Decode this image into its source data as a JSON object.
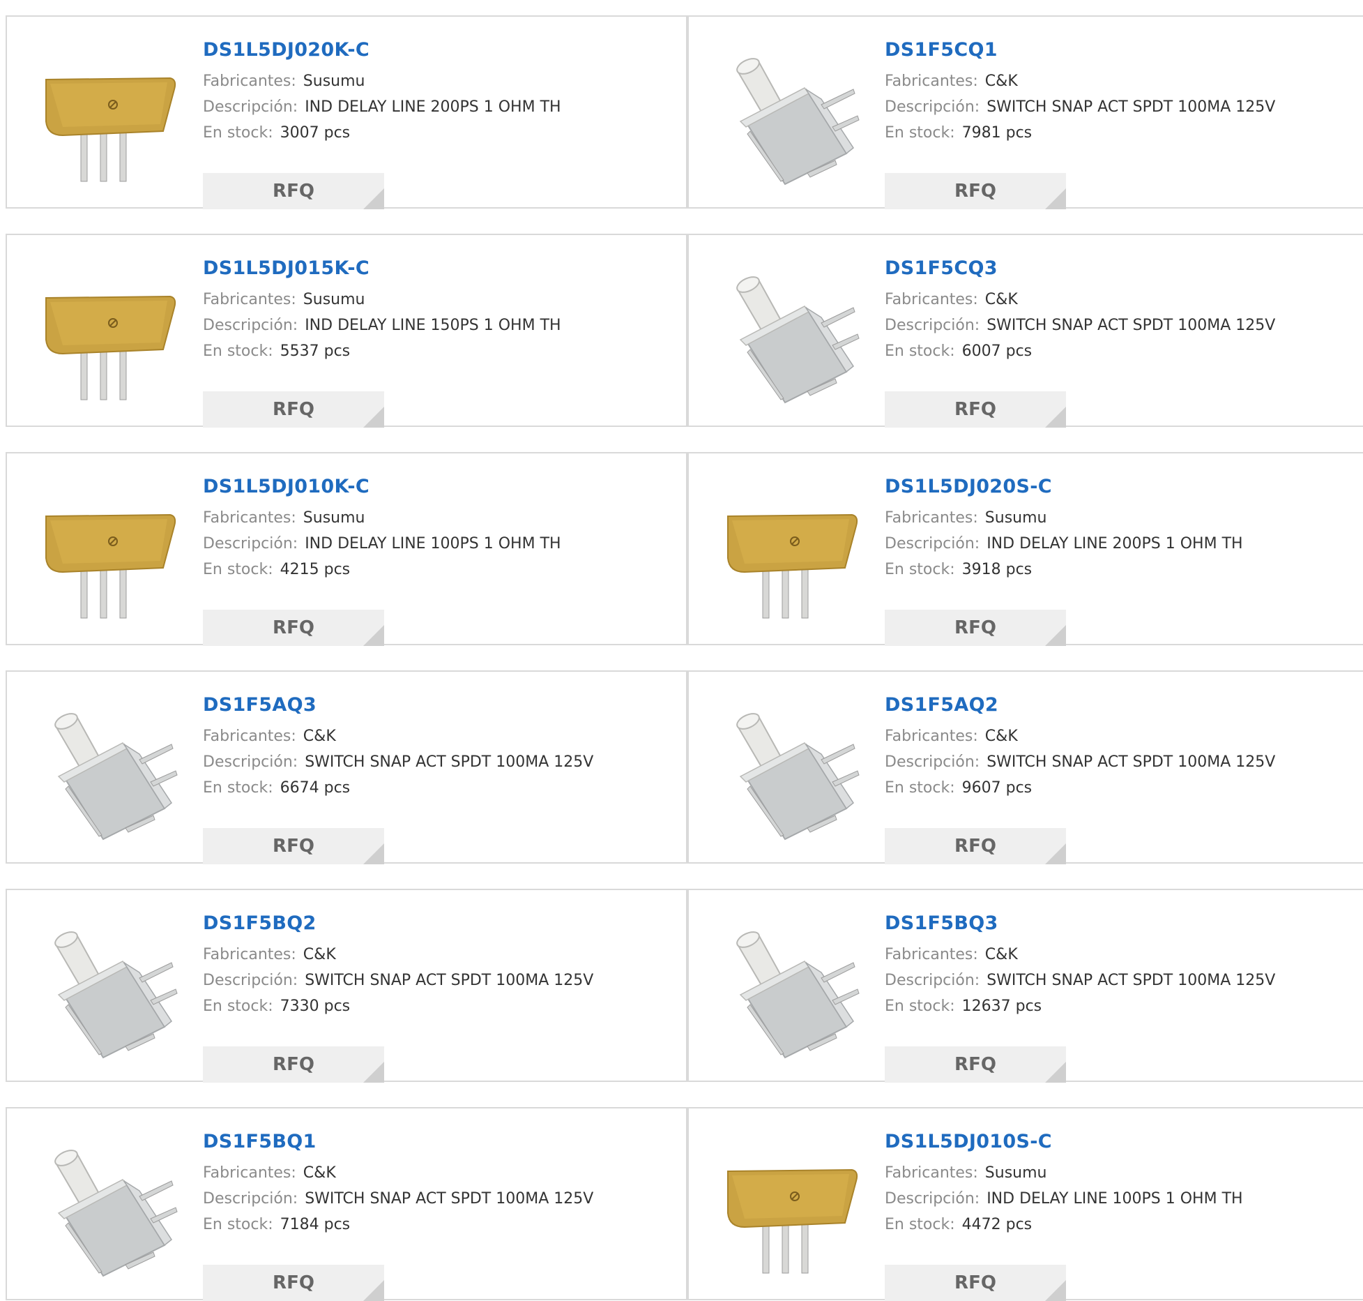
{
  "labels": {
    "manufacturer": "Fabricantes:",
    "description": "Descripción:",
    "stock": "En stock:",
    "rfq": "RFQ"
  },
  "products": [
    {
      "part": "DS1L5DJ020K-C",
      "manufacturer": "Susumu",
      "description": "IND DELAY LINE 200PS 1 OHM TH",
      "stock": "3007 pcs",
      "image": "delay-line"
    },
    {
      "part": "DS1F5CQ1",
      "manufacturer": "C&K",
      "description": "SWITCH SNAP ACT SPDT 100MA 125V",
      "stock": "7981 pcs",
      "image": "snap-switch"
    },
    {
      "part": "DS1L5DJ015K-C",
      "manufacturer": "Susumu",
      "description": "IND DELAY LINE 150PS 1 OHM TH",
      "stock": "5537 pcs",
      "image": "delay-line"
    },
    {
      "part": "DS1F5CQ3",
      "manufacturer": "C&K",
      "description": "SWITCH SNAP ACT SPDT 100MA 125V",
      "stock": "6007 pcs",
      "image": "snap-switch"
    },
    {
      "part": "DS1L5DJ010K-C",
      "manufacturer": "Susumu",
      "description": "IND DELAY LINE 100PS 1 OHM TH",
      "stock": "4215 pcs",
      "image": "delay-line"
    },
    {
      "part": "DS1L5DJ020S-C",
      "manufacturer": "Susumu",
      "description": "IND DELAY LINE 200PS 1 OHM TH",
      "stock": "3918 pcs",
      "image": "delay-line"
    },
    {
      "part": "DS1F5AQ3",
      "manufacturer": "C&K",
      "description": "SWITCH SNAP ACT SPDT 100MA 125V",
      "stock": "6674 pcs",
      "image": "snap-switch"
    },
    {
      "part": "DS1F5AQ2",
      "manufacturer": "C&K",
      "description": "SWITCH SNAP ACT SPDT 100MA 125V",
      "stock": "9607 pcs",
      "image": "snap-switch"
    },
    {
      "part": "DS1F5BQ2",
      "manufacturer": "C&K",
      "description": "SWITCH SNAP ACT SPDT 100MA 125V",
      "stock": "7330 pcs",
      "image": "snap-switch"
    },
    {
      "part": "DS1F5BQ3",
      "manufacturer": "C&K",
      "description": "SWITCH SNAP ACT SPDT 100MA 125V",
      "stock": "12637 pcs",
      "image": "snap-switch"
    },
    {
      "part": "DS1F5BQ1",
      "manufacturer": "C&K",
      "description": "SWITCH SNAP ACT SPDT 100MA 125V",
      "stock": "7184 pcs",
      "image": "snap-switch"
    },
    {
      "part": "DS1L5DJ010S-C",
      "manufacturer": "Susumu",
      "description": "IND DELAY LINE 100PS 1 OHM TH",
      "stock": "4472 pcs",
      "image": "delay-line"
    }
  ]
}
